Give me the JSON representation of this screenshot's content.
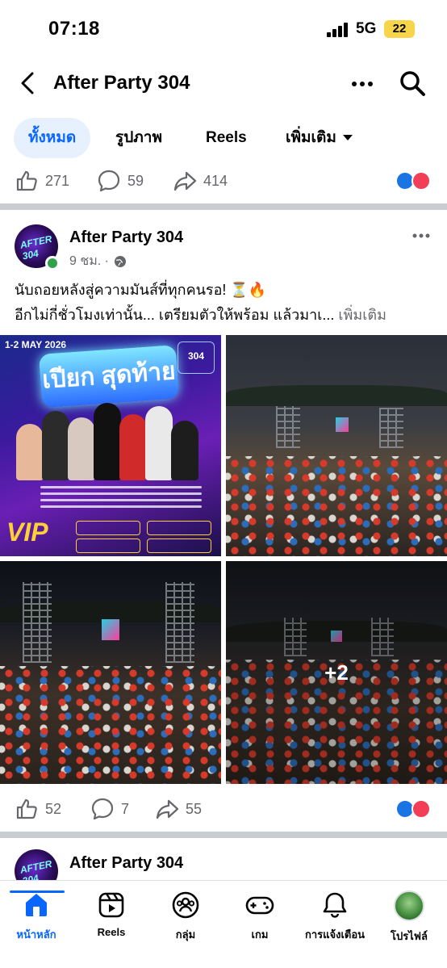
{
  "status_bar": {
    "time": "07:18",
    "network": "5G",
    "battery": "22"
  },
  "header": {
    "title": "After Party 304"
  },
  "tabs": [
    {
      "label": "ทั้งหมด",
      "active": true
    },
    {
      "label": "รูปภาพ"
    },
    {
      "label": "Reels"
    },
    {
      "label": "เพิ่มเติม"
    }
  ],
  "top_reactions": {
    "likes": "271",
    "comments": "59",
    "shares": "414"
  },
  "post": {
    "author": "After Party 304",
    "time": "9 ชม. ·",
    "text_line1": "นับถอยหลังสู่ความมันส์ที่ทุกคนรอ! ⏳🔥",
    "text_line2": "อีกไม่กี่ชั่วโมงเท่านั้น... เตรียมตัวให้พร้อม แล้วมาเ...",
    "see_more": "เพิ่มเติม",
    "extra_photos": "+2",
    "poster": {
      "date": "1-2 MAY 2026",
      "title": "เปียก สุดท้าย",
      "venue": "304",
      "vip": "VIP"
    },
    "reactions": {
      "likes": "52",
      "comments": "7",
      "shares": "55"
    }
  },
  "next_post": {
    "author": "After Party 304"
  },
  "bottom_nav": [
    {
      "label": "หน้าหลัก",
      "icon": "home-icon",
      "active": true
    },
    {
      "label": "Reels",
      "icon": "reels-icon"
    },
    {
      "label": "กลุ่ม",
      "icon": "groups-icon"
    },
    {
      "label": "เกม",
      "icon": "gaming-icon"
    },
    {
      "label": "การแจ้งเตือน",
      "icon": "bell-icon"
    },
    {
      "label": "โปรไฟล์",
      "icon": "profile-avatar"
    }
  ],
  "colors": {
    "accent": "#0866ff",
    "like": "#1b74e4",
    "love": "#f33e58",
    "online": "#31a24c",
    "secondary_text": "#65676b"
  }
}
